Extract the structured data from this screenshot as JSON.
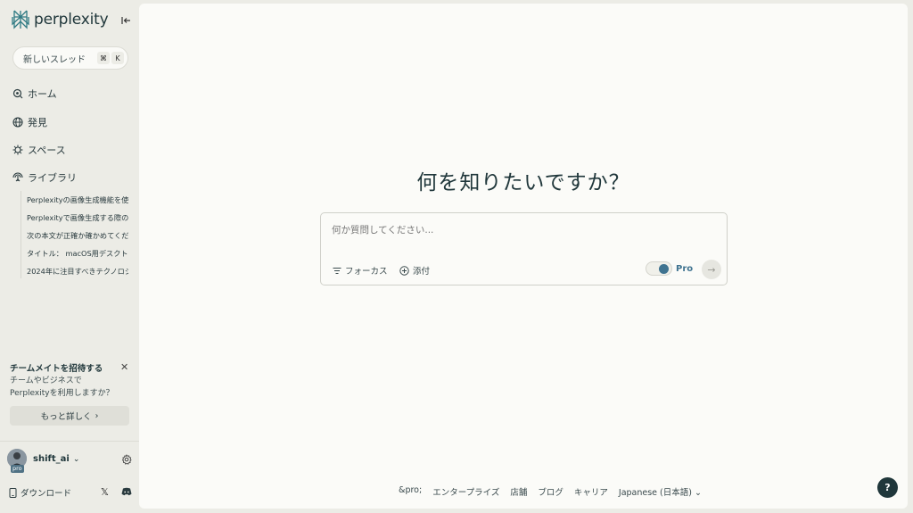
{
  "app": {
    "logo_text": "perplexity"
  },
  "sidebar": {
    "new_thread": {
      "label": "新しいスレッド",
      "shortcut_key1": "⌘",
      "shortcut_key2": "K"
    },
    "nav": [
      {
        "label": "ホーム",
        "icon": "home-search-icon"
      },
      {
        "label": "発見",
        "icon": "globe-icon"
      },
      {
        "label": "スペース",
        "icon": "spaces-icon"
      },
      {
        "label": "ライブラリ",
        "icon": "library-icon"
      }
    ],
    "library_items": [
      "Perplexityの画像生成機能を使",
      "Perplexityで画像生成する際の",
      "次の本文が正確か確かめてくだ",
      "タイトル： macOS用デスクト",
      "2024年に注目すべきテクノロジ"
    ],
    "invite": {
      "title": "チームメイトを招待する",
      "desc_line1": "チームやビジネスで",
      "desc_line2": "Perplexityを利用しますか？",
      "more_label": "もっと詳しく"
    },
    "user": {
      "name": "shift_ai",
      "badge": "pro"
    },
    "download_label": "ダウンロード"
  },
  "main": {
    "headline": "何を知りたいですか？",
    "search": {
      "placeholder": "何か質問してください...",
      "focus_label": "フォーカス",
      "attach_label": "添付",
      "pro_label": "Pro",
      "pro_enabled": true
    },
    "footer": {
      "links": [
        "&pro;",
        "エンタープライズ",
        "店舗",
        "ブログ",
        "キャリア"
      ],
      "language": "Japanese (日本語)"
    },
    "help_label": "?"
  },
  "colors": {
    "accent": "#3f7390",
    "dark": "#20373b",
    "sidebar_bg": "#ecece6",
    "main_bg": "#fbfbf8"
  }
}
